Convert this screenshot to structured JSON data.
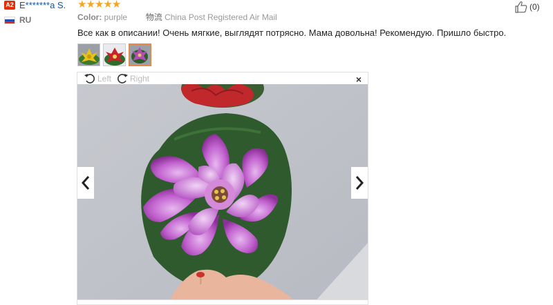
{
  "reviewer": {
    "badge": "A2",
    "name": "E*******a S.",
    "country": "RU",
    "stars": "★★★★★"
  },
  "meta": {
    "color_label": "Color:",
    "color_value": "purple",
    "shipping_label": "物流",
    "shipping_value": "China Post Registered Air Mail"
  },
  "likes": {
    "count": "(0)",
    "icon": "thumbs-up-icon"
  },
  "review_text": "Все как в описании! Очень мягкие, выглядят потрясно. Мама довольна! Рекомендую. Пришло быстро.",
  "thumbnails": [
    {
      "name": "yellow-lotus",
      "color": "#e8c21a"
    },
    {
      "name": "red-lotus",
      "color": "#c8232b"
    },
    {
      "name": "purple-lotus",
      "color": "#b14fb0",
      "selected": true
    }
  ],
  "viewer": {
    "rotate_left": "Left",
    "rotate_right": "Right",
    "close": "×",
    "prev_icon": "chevron-left-icon",
    "next_icon": "chevron-right-icon"
  },
  "colors": {
    "username": "#0b56b5",
    "badge": "#e62e04",
    "star": "#f5a623",
    "selected_border": "#e8894a"
  }
}
